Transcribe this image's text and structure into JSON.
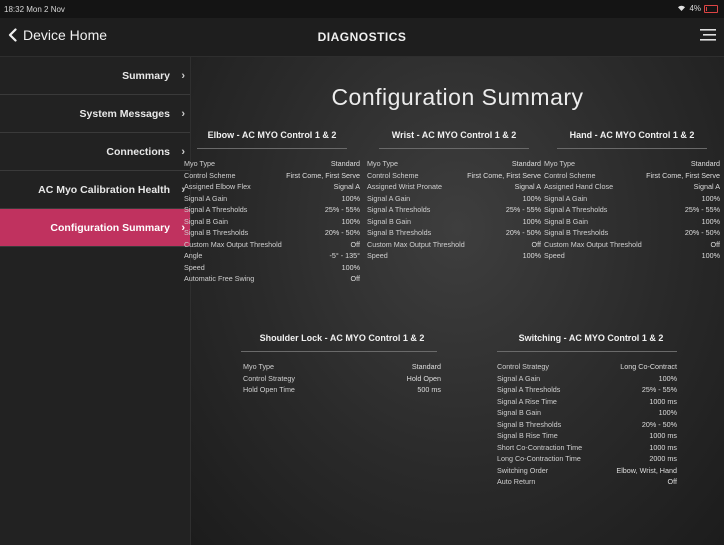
{
  "status": {
    "time": "18:32  Mon 2 Nov",
    "battery": "4%"
  },
  "nav": {
    "back_label": "Device Home",
    "title": "DIAGNOSTICS"
  },
  "sidebar": {
    "items": [
      {
        "label": "Summary",
        "active": false
      },
      {
        "label": "System Messages",
        "active": false
      },
      {
        "label": "Connections",
        "active": false
      },
      {
        "label": "AC Myo Calibration Health",
        "active": false
      },
      {
        "label": "Configuration Summary",
        "active": true
      }
    ]
  },
  "main": {
    "title": "Configuration Summary",
    "elbow": {
      "heading": "Elbow - AC MYO Control 1 & 2",
      "rows": [
        {
          "k": "Myo Type",
          "v": "Standard"
        },
        {
          "k": "Control Scheme",
          "v": "First Come, First Serve"
        },
        {
          "k": "Assigned Elbow Flex",
          "v": "Signal A"
        },
        {
          "k": "Signal A Gain",
          "v": "100%"
        },
        {
          "k": "Signal A Thresholds",
          "v": "25% - 55%"
        },
        {
          "k": "Signal B Gain",
          "v": "100%"
        },
        {
          "k": "Signal B Thresholds",
          "v": "20% - 50%"
        },
        {
          "k": "Custom Max Output Threshold",
          "v": "Off"
        },
        {
          "k": "Angle",
          "v": "-5° - 135°"
        },
        {
          "k": "Speed",
          "v": "100%"
        },
        {
          "k": "Automatic Free Swing",
          "v": "Off"
        }
      ]
    },
    "wrist": {
      "heading": "Wrist - AC MYO Control 1 & 2",
      "rows": [
        {
          "k": "Myo Type",
          "v": "Standard"
        },
        {
          "k": "Control Scheme",
          "v": "First Come, First Serve"
        },
        {
          "k": "Assigned Wrist Pronate",
          "v": "Signal A"
        },
        {
          "k": "Signal A Gain",
          "v": "100%"
        },
        {
          "k": "Signal A Thresholds",
          "v": "25% - 55%"
        },
        {
          "k": "Signal B Gain",
          "v": "100%"
        },
        {
          "k": "Signal B Thresholds",
          "v": "20% - 50%"
        },
        {
          "k": "Custom Max Output Threshold",
          "v": "Off"
        },
        {
          "k": "Speed",
          "v": "100%"
        }
      ]
    },
    "hand": {
      "heading": "Hand - AC MYO Control 1 & 2",
      "rows": [
        {
          "k": "Myo Type",
          "v": "Standard"
        },
        {
          "k": "Control Scheme",
          "v": "First Come, First Serve"
        },
        {
          "k": "Assigned Hand Close",
          "v": "Signal A"
        },
        {
          "k": "Signal A Gain",
          "v": "100%"
        },
        {
          "k": "Signal A Thresholds",
          "v": "25% - 55%"
        },
        {
          "k": "Signal B Gain",
          "v": "100%"
        },
        {
          "k": "Signal B Thresholds",
          "v": "20% - 50%"
        },
        {
          "k": "Custom Max Output Threshold",
          "v": "Off"
        },
        {
          "k": "Speed",
          "v": "100%"
        }
      ]
    },
    "shoulder": {
      "heading": "Shoulder Lock - AC MYO Control 1 & 2",
      "rows": [
        {
          "k": "Myo Type",
          "v": "Standard"
        },
        {
          "k": "Control Strategy",
          "v": "Hold Open"
        },
        {
          "k": "Hold Open Time",
          "v": "500 ms"
        }
      ]
    },
    "switching": {
      "heading": "Switching - AC MYO Control 1 & 2",
      "rows": [
        {
          "k": "Control Strategy",
          "v": "Long Co-Contract"
        },
        {
          "k": "Signal A Gain",
          "v": "100%"
        },
        {
          "k": "Signal A Thresholds",
          "v": "25% - 55%"
        },
        {
          "k": "Signal A Rise Time",
          "v": "1000 ms"
        },
        {
          "k": "Signal B Gain",
          "v": "100%"
        },
        {
          "k": "Signal B Thresholds",
          "v": "20% - 50%"
        },
        {
          "k": "Signal B Rise Time",
          "v": "1000 ms"
        },
        {
          "k": "Short Co-Contraction Time",
          "v": "1000 ms"
        },
        {
          "k": "Long Co-Contraction Time",
          "v": "2000 ms"
        },
        {
          "k": "Switching Order",
          "v": "Elbow, Wrist, Hand"
        },
        {
          "k": "Auto Return",
          "v": "Off"
        }
      ]
    }
  },
  "colors": {
    "accent": "#c0325f",
    "background": "#1a1a1a",
    "panel": "#222222"
  },
  "icons": {
    "back": "chevron-left-icon",
    "menu": "hamburger-menu-icon",
    "wifi": "wifi-icon",
    "battery": "battery-icon",
    "sidebar_chevron": "chevron-right-icon"
  }
}
